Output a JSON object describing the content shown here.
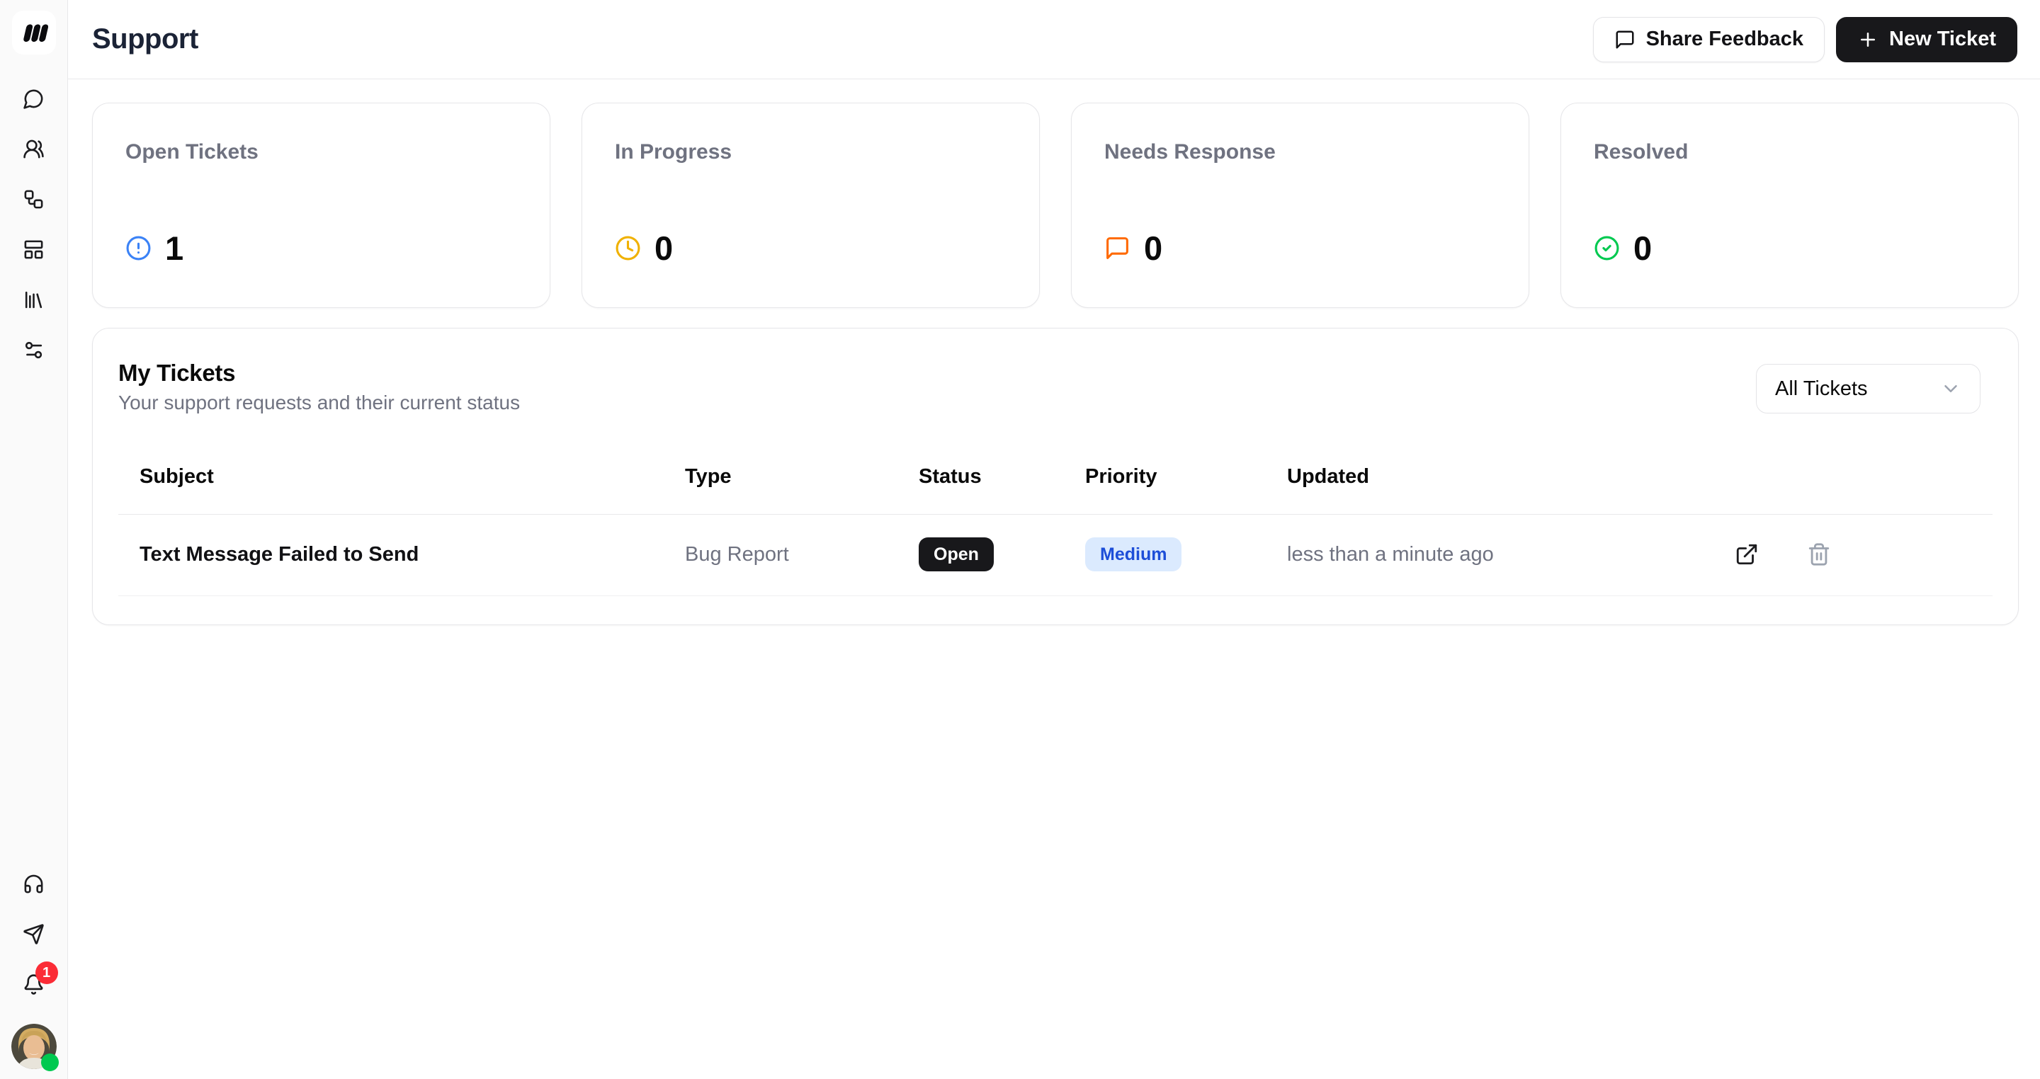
{
  "app": {
    "title": "Support"
  },
  "header": {
    "share_feedback_label": "Share Feedback",
    "new_ticket_label": "New Ticket"
  },
  "sidebar": {
    "nav_icons": [
      "message-circle-icon",
      "users-icon",
      "workflow-icon",
      "dashboard-icon",
      "library-icon",
      "settings-sliders-icon"
    ],
    "bottom_icons": [
      "headphones-icon",
      "send-icon",
      "bell-icon",
      "avatar"
    ],
    "notification_count": "1"
  },
  "stats": [
    {
      "label": "Open Tickets",
      "value": "1",
      "icon": "alert-circle-icon",
      "icon_color": "#3b82f6"
    },
    {
      "label": "In Progress",
      "value": "0",
      "icon": "clock-icon",
      "icon_color": "#f0b100"
    },
    {
      "label": "Needs Response",
      "value": "0",
      "icon": "message-square-icon",
      "icon_color": "#ff6900"
    },
    {
      "label": "Resolved",
      "value": "0",
      "icon": "circle-check-icon",
      "icon_color": "#00c950"
    }
  ],
  "tickets": {
    "title": "My Tickets",
    "subtitle": "Your support requests and their current status",
    "filter_value": "All Tickets",
    "columns": {
      "subject": "Subject",
      "type": "Type",
      "status": "Status",
      "priority": "Priority",
      "updated": "Updated"
    },
    "rows": [
      {
        "subject": "Text Message Failed to Send",
        "type": "Bug Report",
        "status": "Open",
        "priority": "Medium",
        "updated": "less than a minute ago"
      }
    ]
  },
  "colors": {
    "sidebar_bg": "#fafafa",
    "border": "#e6e6e9",
    "muted_text": "#6f7280",
    "dark_button": "#18181b",
    "open_badge_bg": "#18181b",
    "medium_badge_bg": "#dbeafe",
    "medium_badge_text": "#1d4ed8",
    "notification_red": "#fb2c36",
    "online_green": "#00c950"
  }
}
